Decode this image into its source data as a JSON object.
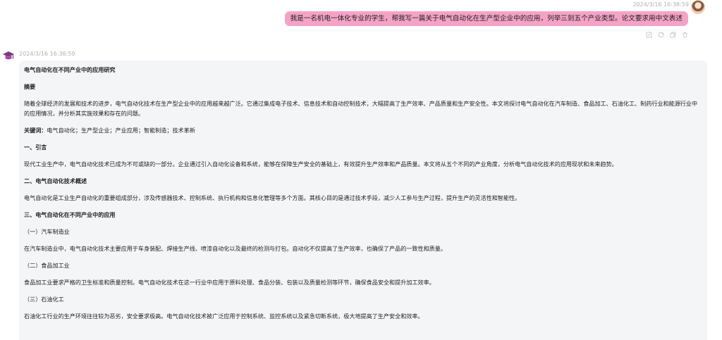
{
  "user_message": {
    "timestamp": "2024/3/16 16:38:59",
    "text": "我是一名机电一体化专业的学生，帮我写一篇关于电气自动化在生产型企业中的应用，列举三到五个产业类型。论文要求用中文表述",
    "actions": [
      "edit-icon",
      "refresh-icon",
      "copy-icon",
      "delete-icon"
    ]
  },
  "ai_message": {
    "timestamp": "2024/3/16 16:38:59",
    "title": "电气自动化在不同产业中的应用研究",
    "abstract_heading": "摘要",
    "abstract_body": "随着全球经济的发展和技术的进步，电气自动化技术在生产型企业中的应用越来越广泛。它通过集成电子技术、信息技术和自动控制技术，大幅提高了生产效率、产品质量和生产安全性。本文将探讨电气自动化在汽车制造、食品加工、石油化工、制药行业和能源行业中的应用情况，并分析其实施效果和存在的问题。",
    "keywords_label": "关键词：",
    "keywords": "电气自动化；生产型企业；产业应用；智能制造；技术革新",
    "s1_heading": "一、引言",
    "s1_body": "现代工业生产中，电气自动化技术已成为不可或缺的一部分。企业通过引入自动化设备和系统，能够在保障生产安全的基础上，有效提升生产效率和产品质量。本文将从五个不同的产业角度，分析电气自动化技术的应用现状和未来趋势。",
    "s2_heading": "二、电气自动化技术概述",
    "s2_body": "电气自动化是工业生产自动化的重要组成部分，涉及传感器技术、控制系统、执行机构和信息化管理等多个方面。其核心目的是通过技术手段，减少人工参与生产过程，提升生产的灵活性和智能性。",
    "s3_heading": "三、电气自动化在不同产业中的应用",
    "sub1_heading": "（一）汽车制造业",
    "sub1_body": "在汽车制造业中，电气自动化技术主要应用于车身装配、焊接生产线、喷漆自动化以及最终的检测与打包。自动化不仅提高了生产效率，也确保了产品的一致性和质量。",
    "sub2_heading": "（二）食品加工业",
    "sub2_body": "食品加工业要求严格的卫生标准和质量控制。电气自动化技术在这一行业中应用于原料处理、食品分装、包装以及质量检测等环节，确保食品安全和提升加工效率。",
    "sub3_heading": "（三）石油化工",
    "sub3_body": "石油化工行业的生产环境往往较为恶劣，安全要求极高。电气自动化技术被广泛应用于控制系统、监控系统以及紧急切断系统，极大地提高了生产安全和效率。"
  },
  "colors": {
    "user_bubble": "#f4a3c6",
    "ai_card": "#f4f5f7",
    "timestamp": "#b0b0b0"
  }
}
